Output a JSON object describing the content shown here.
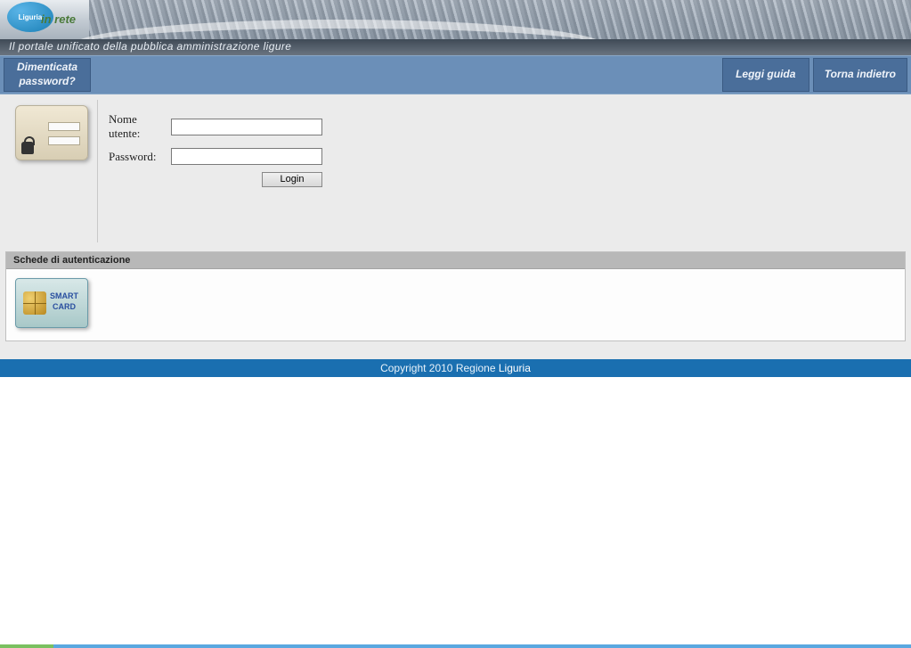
{
  "brand": {
    "name": "Liguria",
    "suffix": "in rete"
  },
  "tagline": "Il portale unificato della pubblica amministrazione ligure",
  "toolbar": {
    "forgot_line1": "Dimenticata",
    "forgot_line2": "password?",
    "guide": "Leggi guida",
    "back": "Torna indietro"
  },
  "login": {
    "username_label": "Nome utente:",
    "password_label": "Password:",
    "username_value": "",
    "password_value": "",
    "submit": "Login"
  },
  "auth_panel": {
    "title": "Schede di autenticazione",
    "smartcard_line1": "SMART",
    "smartcard_line2": "CARD"
  },
  "footer": {
    "prefix": "Copyright 2010 Regione ",
    "region": "Liguria"
  }
}
